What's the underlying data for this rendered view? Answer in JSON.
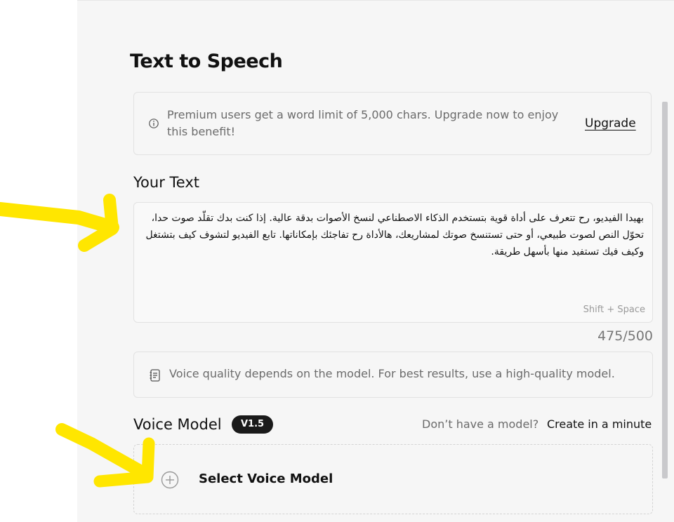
{
  "page": {
    "title": "Text to Speech"
  },
  "notice": {
    "text": "Premium users get a word limit of 5,000 chars. Upgrade now to enjoy this benefit!",
    "upgrade_label": "Upgrade",
    "icon": "info-icon"
  },
  "your_text": {
    "label": "Your Text",
    "value": "بهيدا الفيديو، رح تتعرف على أداة قوية بتستخدم الذكاء الاصطناعي لنسخ الأصوات بدقة عالية. إذا كنت بدك تقلّد صوت حدا، تحوّل النص لصوت طبيعي، أو حتى تستنسخ صوتك لمشاريعك، هالأداة رح تفاجئك بإمكاناتها. تابع الفيديو لتشوف كيف بتشتغل وكيف فيك تستفيد منها بأسهل طريقة.",
    "hint": "Shift + Space",
    "counter": "475/500"
  },
  "quality_notice": {
    "text": "Voice quality depends on the model. For best results, use a high-quality model.",
    "icon": "document-icon"
  },
  "voice_model": {
    "label": "Voice Model",
    "badge": "V1.5",
    "no_model_text": "Don’t have a model?",
    "create_label": "Create in a minute",
    "select_label": "Select Voice Model",
    "icon": "plus-circle-icon"
  },
  "annotations": {
    "color": "#ffe600",
    "icons": [
      "arrow-annotation-icon",
      "arrow-annotation-icon"
    ]
  }
}
